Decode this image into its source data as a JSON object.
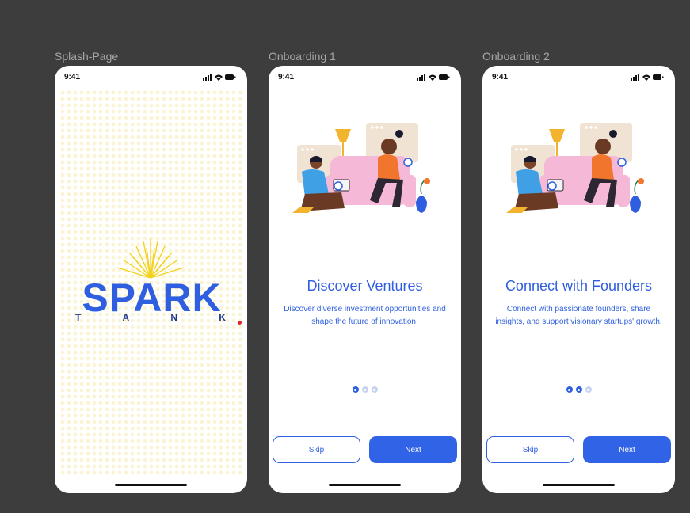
{
  "frames": [
    {
      "label": "Splash-Page"
    },
    {
      "label": "Onboarding 1"
    },
    {
      "label": "Onboarding 2"
    }
  ],
  "status_bar": {
    "time": "9:41"
  },
  "splash": {
    "logo_text": "SPARK",
    "logo_sub": [
      "T",
      "A",
      "N",
      "K"
    ]
  },
  "onboarding_1": {
    "title": "Discover Ventures",
    "description": "Discover diverse investment opportunities and shape the future of innovation.",
    "active_page": 1,
    "skip_label": "Skip",
    "next_label": "Next"
  },
  "onboarding_2": {
    "title": "Connect with Founders",
    "description": "Connect with passionate founders, share insights, and support visionary startups' growth.",
    "active_page": 2,
    "skip_label": "Skip",
    "next_label": "Next"
  },
  "colors": {
    "primary": "#2f5fe0",
    "background": "#3d3d3d",
    "accent_red": "#e0242b",
    "logo_yellow": "#f2d21e"
  }
}
